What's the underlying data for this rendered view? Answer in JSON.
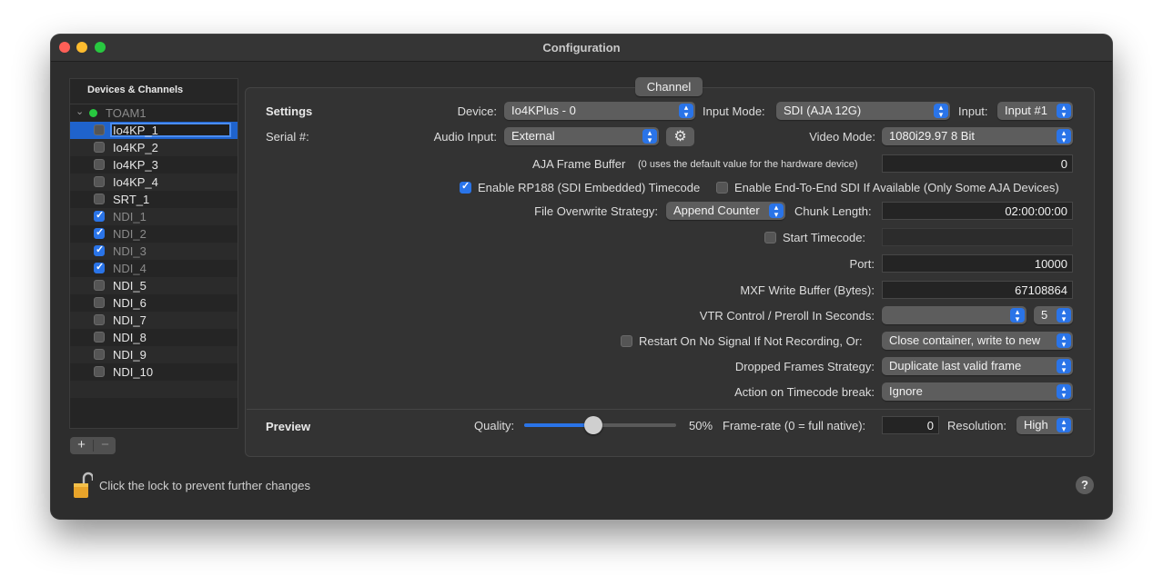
{
  "window": {
    "title": "Configuration"
  },
  "colors": {
    "close": "#fe5f57",
    "minimize": "#febc2e",
    "zoom": "#28c840",
    "accent": "#2a74e8",
    "status_dot": "#28c840"
  },
  "sidebar": {
    "header": "Devices & Channels",
    "group": "TOAM1",
    "items": [
      {
        "label": "Io4KP_1",
        "checked": false,
        "selected": true
      },
      {
        "label": "Io4KP_2",
        "checked": false
      },
      {
        "label": "Io4KP_3",
        "checked": false
      },
      {
        "label": "Io4KP_4",
        "checked": false
      },
      {
        "label": "SRT_1",
        "checked": false
      },
      {
        "label": "NDI_1",
        "checked": true
      },
      {
        "label": "NDI_2",
        "checked": true
      },
      {
        "label": "NDI_3",
        "checked": true
      },
      {
        "label": "NDI_4",
        "checked": true
      },
      {
        "label": "NDI_5",
        "checked": false
      },
      {
        "label": "NDI_6",
        "checked": false
      },
      {
        "label": "NDI_7",
        "checked": false
      },
      {
        "label": "NDI_8",
        "checked": false
      },
      {
        "label": "NDI_9",
        "checked": false
      },
      {
        "label": "NDI_10",
        "checked": false
      }
    ],
    "add_label": "+",
    "remove_label": "−"
  },
  "tab": {
    "label": "Channel"
  },
  "settings": {
    "section_label": "Settings",
    "device_label": "Device:",
    "device_value": "Io4KPlus - 0",
    "input_mode_label": "Input Mode:",
    "input_mode_value": "SDI (AJA 12G)",
    "input_label": "Input:",
    "input_value": "Input #1",
    "serial_label": "Serial #:",
    "audio_input_label": "Audio Input:",
    "audio_input_value": "External",
    "video_mode_label": "Video Mode:",
    "video_mode_value": "1080i29.97 8 Bit",
    "aja_frame_buffer_label": "AJA Frame Buffer",
    "aja_frame_buffer_hint": "(0 uses the default value for the hardware device)",
    "aja_frame_buffer_value": "0",
    "rp188_label": "Enable RP188 (SDI Embedded) Timecode",
    "rp188_checked": true,
    "end_to_end_label": "Enable End-To-End SDI If Available (Only Some AJA Devices)",
    "end_to_end_checked": false,
    "overwrite_label": "File Overwrite Strategy:",
    "overwrite_value": "Append Counter",
    "chunk_label": "Chunk Length:",
    "chunk_value": "02:00:00:00",
    "start_tc_label": "Start Timecode:",
    "start_tc_checked": false,
    "start_tc_value": "",
    "port_label": "Port:",
    "port_value": "10000",
    "mxf_label": "MXF Write Buffer (Bytes):",
    "mxf_value": "67108864",
    "vtr_label": "VTR Control / Preroll In Seconds:",
    "vtr_value": "",
    "preroll_value": "5",
    "restart_label": "Restart On No Signal If Not Recording, Or:",
    "restart_checked": false,
    "restart_value": "Close container, write to new",
    "dropped_label": "Dropped Frames Strategy:",
    "dropped_value": "Duplicate last valid frame",
    "tc_break_label": "Action on Timecode break:",
    "tc_break_value": "Ignore"
  },
  "preview": {
    "section_label": "Preview",
    "quality_label": "Quality:",
    "quality_value": 0.5,
    "quality_text": "50%",
    "framerate_label": "Frame-rate (0 = full native):",
    "framerate_value": "0",
    "resolution_label": "Resolution:",
    "resolution_value": "High"
  },
  "footer": {
    "lock_text": "Click the lock to prevent further changes",
    "help_label": "?"
  }
}
